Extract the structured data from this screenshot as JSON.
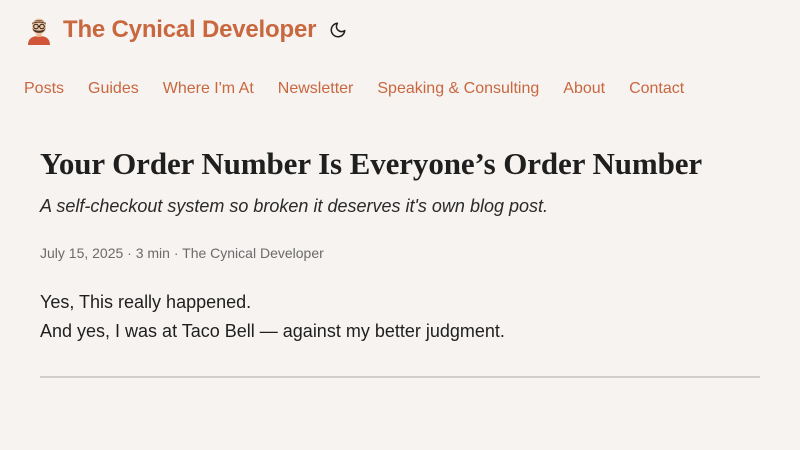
{
  "site": {
    "title": "The Cynical Developer"
  },
  "nav": {
    "items": [
      {
        "label": "Posts"
      },
      {
        "label": "Guides"
      },
      {
        "label": "Where I'm At"
      },
      {
        "label": "Newsletter"
      },
      {
        "label": "Speaking & Consulting"
      },
      {
        "label": "About"
      },
      {
        "label": "Contact"
      }
    ]
  },
  "post": {
    "title": "Your Order Number Is Everyone’s Order Number",
    "subtitle": "A self-checkout system so broken it deserves it's own blog post.",
    "meta": "July 15, 2025 · 3 min · The Cynical Developer",
    "body": [
      "Yes, This really happened.",
      "And yes, I was at Taco Bell — against my better judgment."
    ]
  },
  "icons": {
    "avatar": "developer-avatar-icon",
    "theme_toggle": "moon-icon"
  },
  "colors": {
    "background": "#f6f3f1",
    "accent": "#c9673f",
    "text": "#1f1f1f",
    "muted": "#6b6b6b",
    "divider": "#d0cdcb"
  }
}
